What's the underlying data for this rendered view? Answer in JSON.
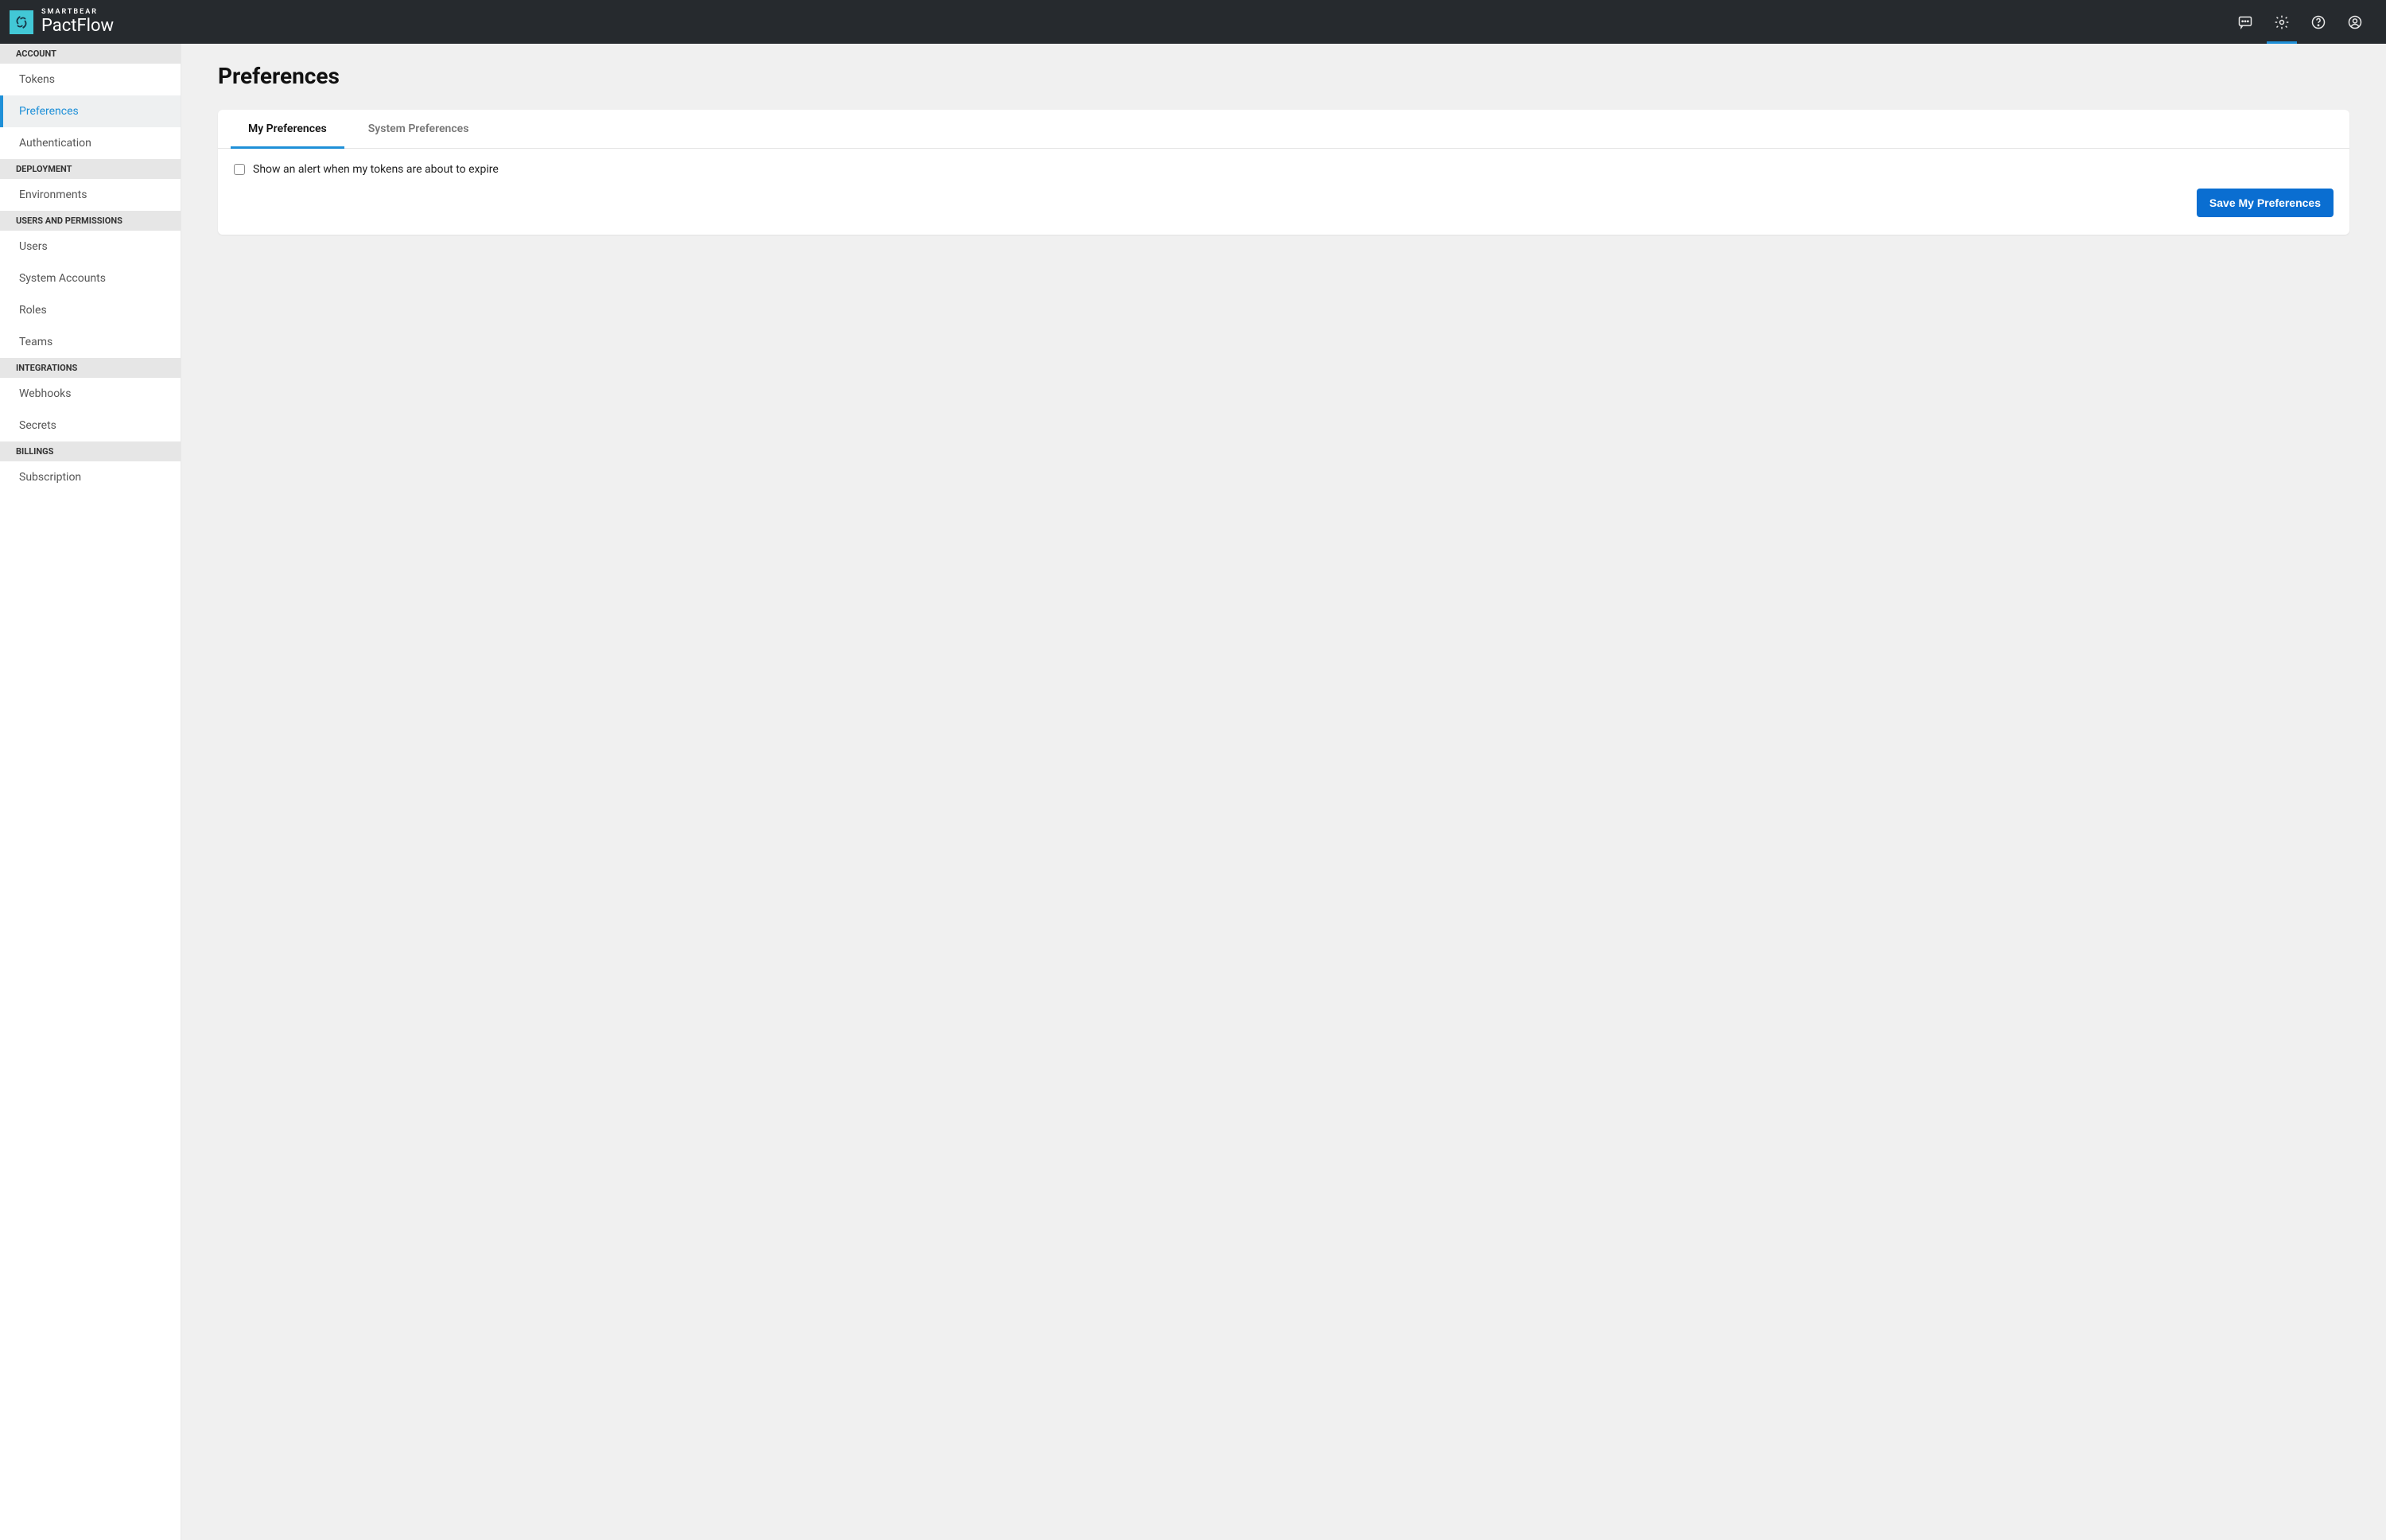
{
  "brand": {
    "company": "SMARTBEAR",
    "product": "PactFlow"
  },
  "sidebar": {
    "sections": [
      {
        "label": "ACCOUNT",
        "items": [
          "Tokens",
          "Preferences",
          "Authentication"
        ]
      },
      {
        "label": "DEPLOYMENT",
        "items": [
          "Environments"
        ]
      },
      {
        "label": "USERS AND PERMISSIONS",
        "items": [
          "Users",
          "System Accounts",
          "Roles",
          "Teams"
        ]
      },
      {
        "label": "INTEGRATIONS",
        "items": [
          "Webhooks",
          "Secrets"
        ]
      },
      {
        "label": "BILLINGS",
        "items": [
          "Subscription"
        ]
      }
    ],
    "active": "Preferences"
  },
  "page": {
    "title": "Preferences"
  },
  "tabs": {
    "items": [
      "My Preferences",
      "System Preferences"
    ],
    "active": "My Preferences"
  },
  "preferences": {
    "token_alert_label": "Show an alert when my tokens are about to expire",
    "token_alert_checked": false,
    "save_label": "Save My Preferences"
  }
}
